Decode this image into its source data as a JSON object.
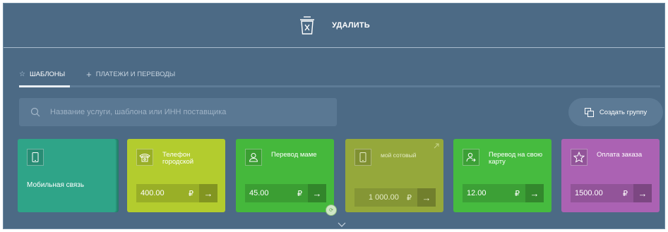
{
  "topbar": {
    "delete_label": "УДАЛИТЬ"
  },
  "tabs": [
    {
      "label": "ШАБЛОНЫ",
      "icon": "star-icon"
    },
    {
      "label": "ПЛАТЕЖИ И ПЕРЕВОДЫ",
      "icon": "plus-icon"
    }
  ],
  "search": {
    "placeholder": "Название услуги, шаблона или ИНН поставщика",
    "value": ""
  },
  "group_button": {
    "label": "Создать группу"
  },
  "cards": [
    {
      "title": "Мобильная связь",
      "icon": "phone-icon",
      "color": "#2fa488"
    },
    {
      "title": "Телефон городской",
      "amount": "400.00",
      "currency": "₽",
      "icon": "landline-icon",
      "color": "#b3cc2e"
    },
    {
      "title": "Перевод маме",
      "amount": "45.00",
      "currency": "₽",
      "icon": "person-icon",
      "color": "#45b83c"
    },
    {
      "title": "мой сотовый",
      "amount": "1 000.00",
      "currency": "₽",
      "icon": "phone-icon",
      "color": "#95a83b"
    },
    {
      "title": "Перевод на свою карту",
      "amount": "12.00",
      "currency": "₽",
      "icon": "person-transfer-icon",
      "color": "#46bb3f"
    },
    {
      "title": "Оплата заказа",
      "amount": "1500.00",
      "currency": "₽",
      "icon": "star-icon",
      "color": "#ab62b3"
    }
  ]
}
